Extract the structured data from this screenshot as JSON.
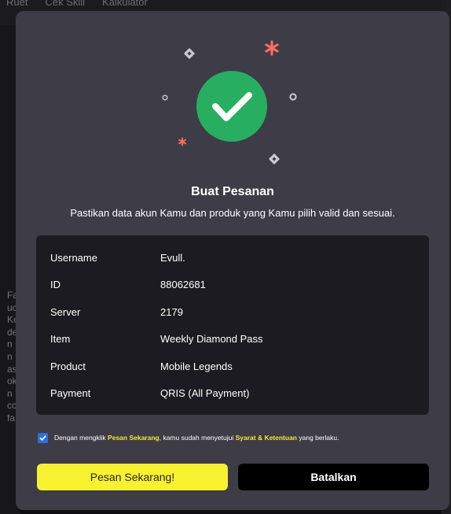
{
  "background": {
    "nav_items": [
      "Ruet",
      "Cek Skill",
      "Kalkulator"
    ],
    "side_text": "Fa\nuc\nKe\nde\nn\nn\nas\nok\nn\ncc\nfa"
  },
  "modal": {
    "title": "Buat Pesanan",
    "subtitle": "Pastikan data akun Kamu dan produk yang Kamu pilih valid dan sesuai.",
    "details": [
      {
        "label": "Username",
        "value": "Evull."
      },
      {
        "label": "ID",
        "value": "88062681"
      },
      {
        "label": "Server",
        "value": "2179"
      },
      {
        "label": "Item",
        "value": "Weekly Diamond Pass"
      },
      {
        "label": "Product",
        "value": "Mobile Legends"
      },
      {
        "label": "Payment",
        "value": "QRIS (All Payment)"
      }
    ],
    "agreement": {
      "checked": true,
      "prefix": "Dengan mengklik ",
      "link1": "Pesan Sekarang",
      "middle": ", kamu sudah menyetujui ",
      "link2": "Syarat & Ketentuan",
      "suffix": " yang berlaku."
    },
    "confirm_label": "Pesan Sekarang!",
    "cancel_label": "Batalkan"
  },
  "colors": {
    "modal_bg": "#3d3c47",
    "panel_bg": "#1c1b21",
    "accent_yellow": "#f7f12f",
    "success_green": "#27ae60",
    "star_red": "#ff6b5f"
  }
}
